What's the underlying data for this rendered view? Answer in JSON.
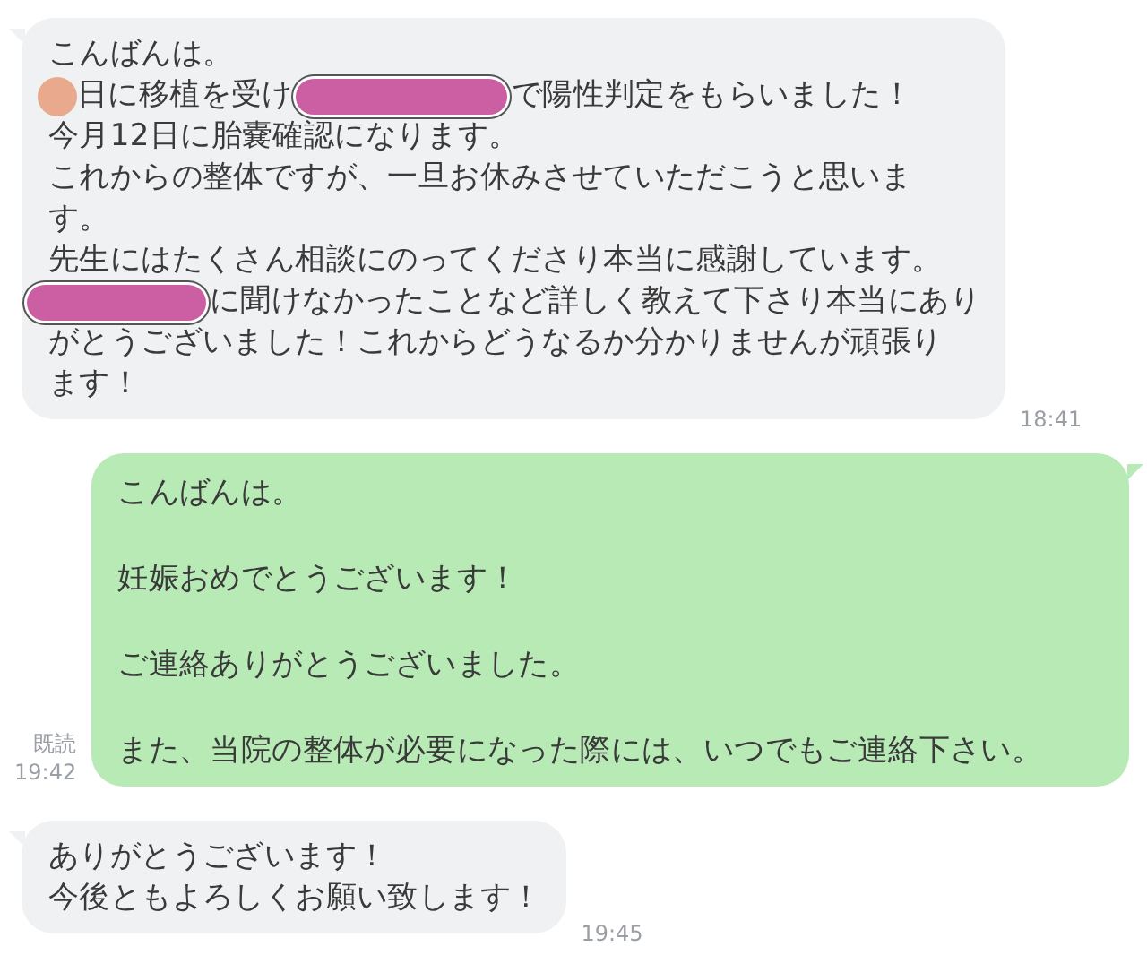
{
  "messages": [
    {
      "kind": "incoming",
      "paragraphs": [
        [
          [
            {
              "kind": "text",
              "text": "こんばんは。"
            }
          ],
          [
            {
              "kind": "blot",
              "color": "#e8a98c"
            },
            {
              "kind": "text",
              "text": "日に移植を受け"
            },
            {
              "kind": "bar",
              "color": "#cc5fa3"
            },
            {
              "kind": "text",
              "text": "で陽性判定をもらいました！"
            }
          ],
          [
            {
              "kind": "text",
              "text": "今月12日に胎嚢確認になります。"
            }
          ],
          [
            {
              "kind": "text",
              "text": "これからの整体ですが、一旦お休みさせていただこうと思いま"
            }
          ],
          [
            {
              "kind": "text",
              "text": "す。"
            }
          ],
          [
            {
              "kind": "text",
              "text": "先生にはたくさん相談にのってくださり本当に感謝しています。"
            }
          ],
          [
            {
              "kind": "bar",
              "color": "#cc5fa3"
            },
            {
              "kind": "text",
              "text": "に聞けなかったことなど詳しく教えて下さり本当にあり"
            }
          ],
          [
            {
              "kind": "text",
              "text": "がとうございました！これからどうなるか分かりませんが頑張り"
            }
          ],
          [
            {
              "kind": "text",
              "text": "ます！"
            }
          ]
        ]
      ],
      "time": "18:41"
    },
    {
      "kind": "outgoing",
      "paragraphs": [
        [
          [
            {
              "kind": "text",
              "text": "こんばんは。"
            }
          ]
        ],
        [
          [
            {
              "kind": "text",
              "text": "妊娠おめでとうございます！"
            }
          ]
        ],
        [
          [
            {
              "kind": "text",
              "text": "ご連絡ありがとうございました。"
            }
          ]
        ],
        [
          [
            {
              "kind": "text",
              "text": "また、当院の整体が必要になった際には、いつでもご連絡下さい。"
            }
          ]
        ]
      ],
      "read": "既読",
      "time": "19:42"
    },
    {
      "kind": "incoming",
      "paragraphs": [
        [
          [
            {
              "kind": "text",
              "text": "ありがとうございます！"
            }
          ],
          [
            {
              "kind": "text",
              "text": "今後ともよろしくお願い致します！"
            }
          ]
        ]
      ],
      "time": "19:45"
    }
  ]
}
